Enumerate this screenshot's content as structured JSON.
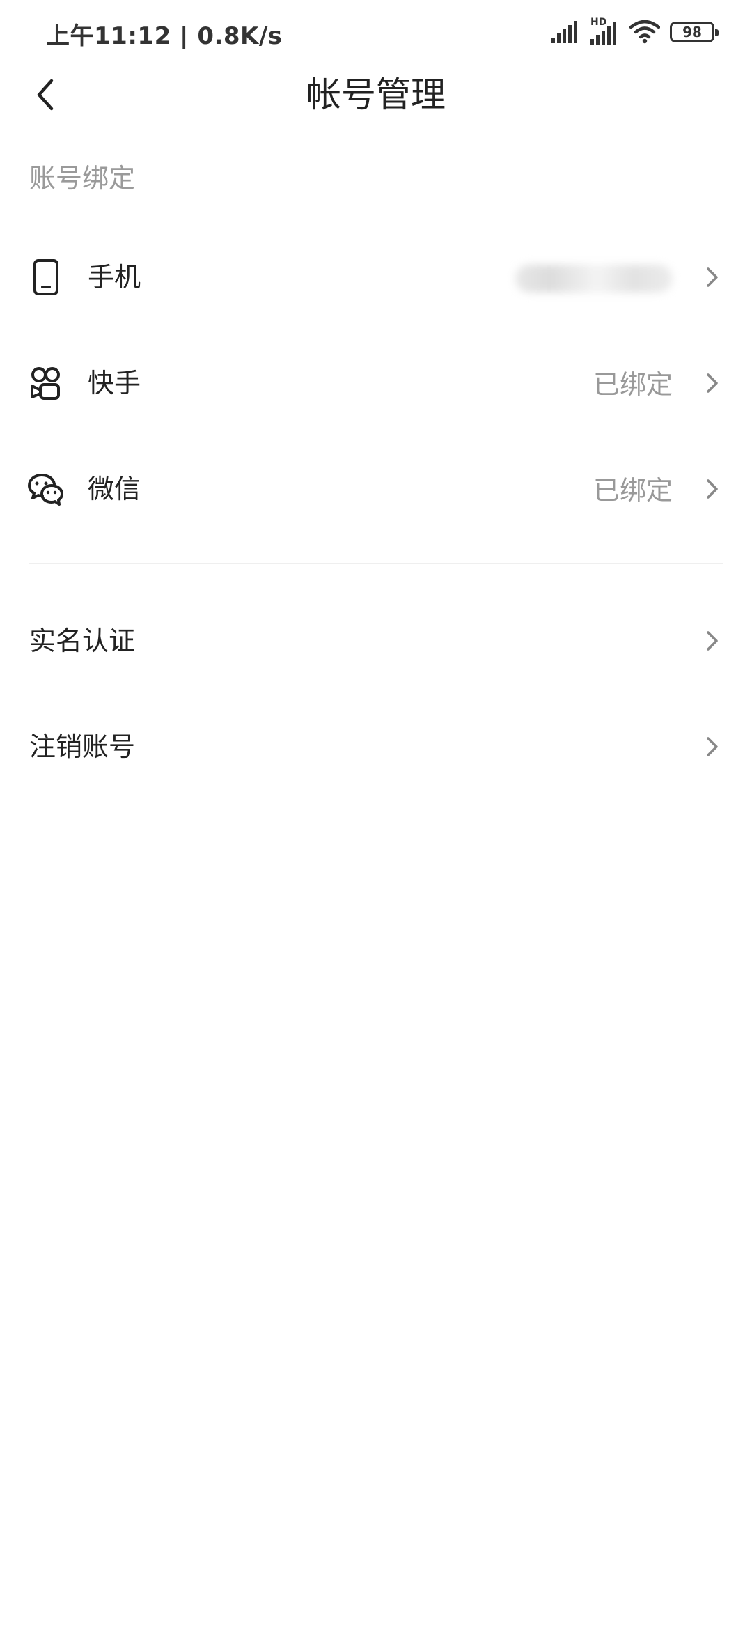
{
  "status_bar": {
    "time_speed": "上午11:12 | 0.8K/s",
    "network_label": "HD",
    "battery": "98"
  },
  "nav": {
    "title": "帐号管理"
  },
  "binding_section": {
    "header": "账号绑定",
    "items": [
      {
        "label": "手机",
        "value": "",
        "icon": "phone-icon"
      },
      {
        "label": "快手",
        "value": "已绑定",
        "icon": "kuaishou-icon"
      },
      {
        "label": "微信",
        "value": "已绑定",
        "icon": "wechat-icon"
      }
    ]
  },
  "other_section": {
    "items": [
      {
        "label": "实名认证"
      },
      {
        "label": "注销账号"
      }
    ]
  }
}
